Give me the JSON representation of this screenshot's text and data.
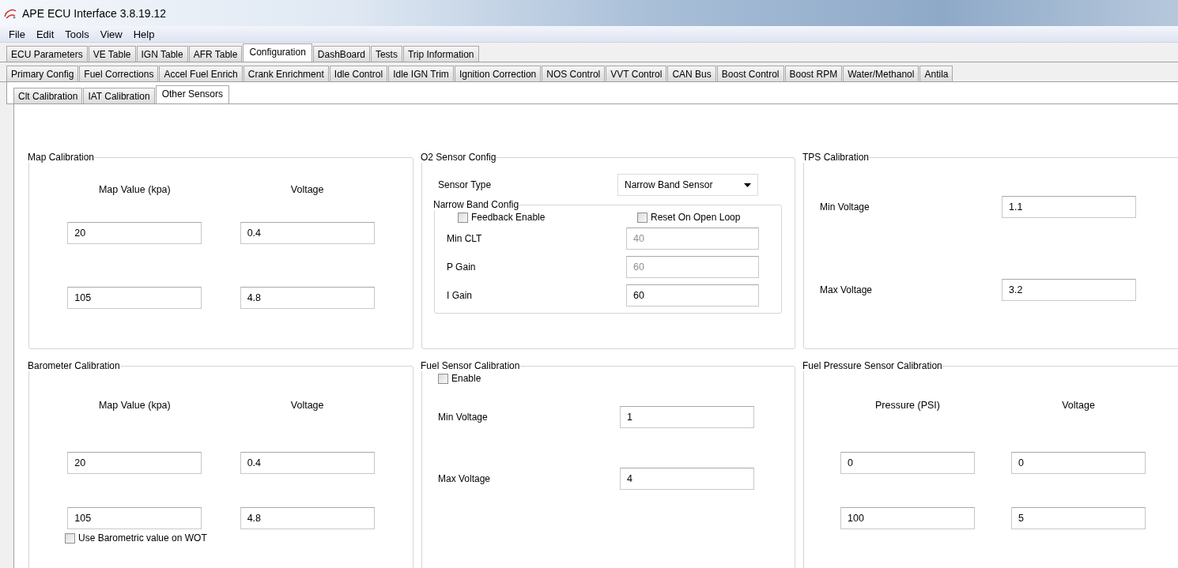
{
  "window": {
    "title": "APE ECU Interface 3.8.19.12"
  },
  "menu": [
    "File",
    "Edit",
    "Tools",
    "View",
    "Help"
  ],
  "main_tabs": [
    {
      "label": "ECU Parameters",
      "selected": false
    },
    {
      "label": "VE Table",
      "selected": false
    },
    {
      "label": "IGN Table",
      "selected": false
    },
    {
      "label": "AFR Table",
      "selected": false
    },
    {
      "label": "Configuration",
      "selected": true
    },
    {
      "label": "DashBoard",
      "selected": false
    },
    {
      "label": "Tests",
      "selected": false
    },
    {
      "label": "Trip Information",
      "selected": false
    }
  ],
  "config_tabs": [
    {
      "label": "Primary Config",
      "selected": false
    },
    {
      "label": "Fuel Corrections",
      "selected": false
    },
    {
      "label": "Accel Fuel Enrich",
      "selected": false
    },
    {
      "label": "Crank Enrichment",
      "selected": false
    },
    {
      "label": "Idle Control",
      "selected": false
    },
    {
      "label": "Idle IGN Trim",
      "selected": false
    },
    {
      "label": "Ignition Correction",
      "selected": false
    },
    {
      "label": "NOS Control",
      "selected": false
    },
    {
      "label": "VVT Control",
      "selected": false
    },
    {
      "label": "CAN Bus",
      "selected": false
    },
    {
      "label": "Boost Control",
      "selected": false
    },
    {
      "label": "Boost RPM",
      "selected": false
    },
    {
      "label": "Water/Methanol",
      "selected": false
    },
    {
      "label": "Antila",
      "selected": false
    }
  ],
  "sensor_tabs": [
    {
      "label": "Clt Calibration",
      "selected": false
    },
    {
      "label": "IAT Calibration",
      "selected": false
    },
    {
      "label": "Other Sensors",
      "selected": true
    }
  ],
  "groups": [
    {
      "kind": "table",
      "title": "Map Calibration",
      "headers": [
        "Map Value (kpa)",
        "Voltage"
      ],
      "rows": [
        [
          "20",
          "0.4"
        ],
        [
          "105",
          "4.8"
        ]
      ]
    },
    {
      "kind": "o2",
      "title": "O2 Sensor Config",
      "select": {
        "label": "Sensor Type",
        "value": "Narrow Band Sensor"
      },
      "subgroup": {
        "title": "Narrow Band Config",
        "checkboxes": [
          {
            "label": "Feedback Enable",
            "checked": false
          },
          {
            "label": "Reset On Open Loop",
            "checked": false
          }
        ],
        "fields": [
          {
            "label": "Min CLT",
            "value": "40",
            "disabled": true
          },
          {
            "label": "P Gain",
            "value": "60",
            "disabled": true
          },
          {
            "label": "I Gain",
            "value": "60",
            "disabled": false
          }
        ]
      }
    },
    {
      "kind": "fields",
      "title": "TPS Calibration",
      "fields": [
        {
          "label": "Min Voltage",
          "value": "1.1",
          "disabled": false
        },
        {
          "label": "Max Voltage",
          "value": "3.2",
          "disabled": false
        }
      ]
    },
    {
      "kind": "table",
      "title": "Barometer Calibration",
      "headers": [
        "Map Value (kpa)",
        "Voltage"
      ],
      "rows": [
        [
          "20",
          "0.4"
        ],
        [
          "105",
          "4.8"
        ]
      ],
      "checkbox": {
        "label": "Use Barometric value on WOT",
        "checked": false
      }
    },
    {
      "kind": "fields",
      "title": "Fuel Sensor Calibration",
      "checkbox": {
        "label": "Enable",
        "checked": false
      },
      "fields": [
        {
          "label": "Min Voltage",
          "value": "1",
          "disabled": false
        },
        {
          "label": "Max Voltage",
          "value": "4",
          "disabled": false
        }
      ]
    },
    {
      "kind": "table",
      "title": "Fuel Pressure Sensor Calibration",
      "headers": [
        "Pressure (PSI)",
        "Voltage"
      ],
      "rows": [
        [
          "0",
          "0"
        ],
        [
          "100",
          "5"
        ]
      ]
    }
  ]
}
